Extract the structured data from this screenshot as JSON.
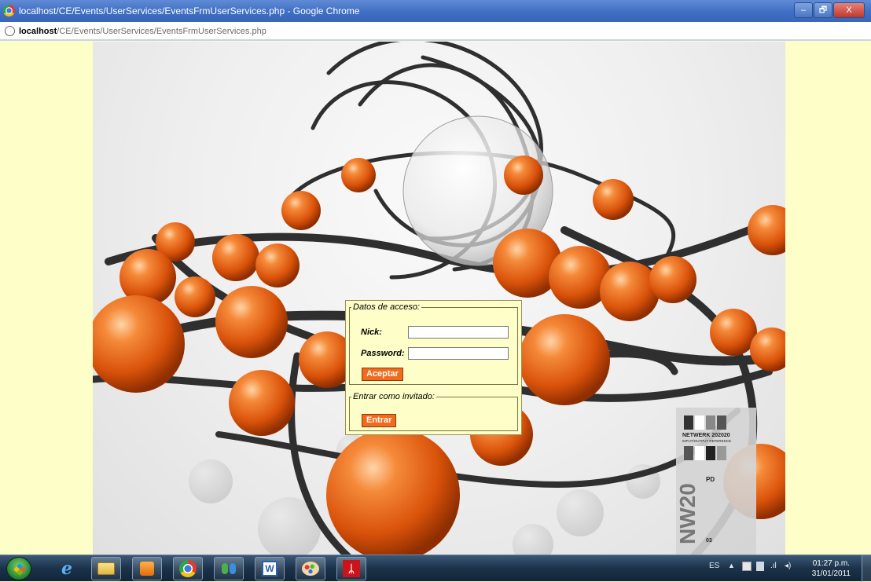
{
  "window": {
    "title": "localhost/CE/Events/UserServices/EventsFrmUserServices.php - Google Chrome",
    "controls": {
      "minimize": "–",
      "maximize": "🗗",
      "close": "X"
    }
  },
  "addressbar": {
    "host": "localhost",
    "path": "/CE/Events/UserServices/EventsFrmUserServices.php"
  },
  "login": {
    "legend": "Datos de acceso:",
    "nick_label": "Nick:",
    "nick_value": "",
    "password_label": "Password:",
    "password_value": "",
    "submit_label": "Aceptar"
  },
  "guest": {
    "legend": "Entrar como invitado:",
    "enter_label": "Entrar"
  },
  "wallpaper_badge": {
    "line1": "NETWERK 202020",
    "line2": "INPUT/OUTPUT REFERENCE",
    "code": "PD",
    "big": "NW20",
    "small": "03"
  },
  "taskbar": {
    "items": [
      "start-orb",
      "internet-explorer-icon",
      "file-explorer-icon",
      "media-player-icon",
      "chrome-icon",
      "live-messenger-icon",
      "word-icon",
      "paint-icon",
      "acrobat-icon"
    ],
    "tray": {
      "language": "ES",
      "time": "01:27 p.m.",
      "date": "31/01/2011"
    }
  },
  "colors": {
    "page_bg": "#fefec8",
    "button_orange": "#f26a1b",
    "titlebar_blue": "#3f6fc3"
  }
}
